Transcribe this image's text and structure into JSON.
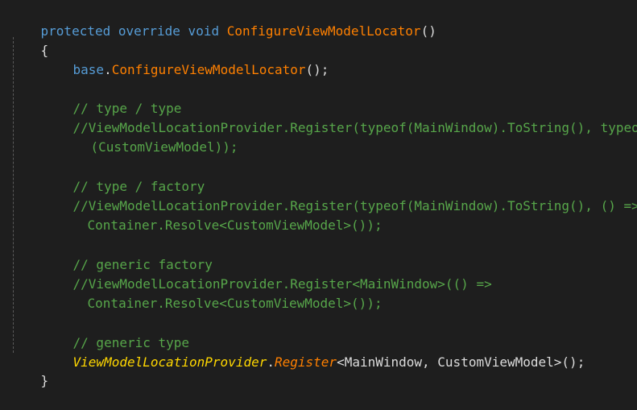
{
  "code": {
    "sig_kw": "protected override void",
    "sig_name": "ConfigureViewModelLocator",
    "sig_parens": "()",
    "open_brace": "{",
    "base_kw": "base",
    "base_dot": ".",
    "base_call": "ConfigureViewModelLocator",
    "base_end": "();",
    "c1_title": "// type / type",
    "c1_line1": "//ViewModelLocationProvider.Register(typeof(MainWindow).ToString(), typeof",
    "c1_line2": "(CustomViewModel));",
    "c2_title": "// type / factory",
    "c2_line1": "//ViewModelLocationProvider.Register(typeof(MainWindow).ToString(), () =>",
    "c2_line2": "Container.Resolve<CustomViewModel>());",
    "c3_title": "// generic factory",
    "c3_line1": "//ViewModelLocationProvider.Register<MainWindow>(() =>",
    "c3_line2": "Container.Resolve<CustomViewModel>());",
    "c4_title": "// generic type",
    "last_class": "ViewModelLocationProvider",
    "last_dot": ".",
    "last_method": "Register",
    "last_generic": "<MainWindow, CustomViewModel>",
    "last_end": "();",
    "close_brace": "}"
  },
  "colors": {
    "background": "#1e1e1e",
    "keyword": "#569cd6",
    "method": "#ff8000",
    "comment": "#57a64a",
    "text": "#dcdcdc",
    "class_italic": "#ffd700"
  }
}
